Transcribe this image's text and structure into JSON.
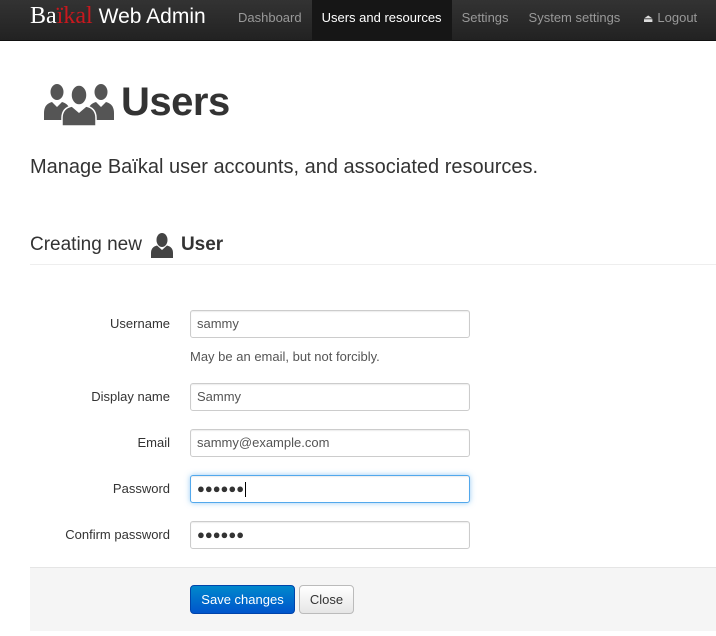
{
  "brand": {
    "part1": "Ba",
    "part2": "ïkal",
    "part3": "Web Admin"
  },
  "nav": {
    "items": [
      {
        "label": "Dashboard"
      },
      {
        "label": "Users and resources"
      },
      {
        "label": "Settings"
      },
      {
        "label": "System settings"
      }
    ],
    "logout_label": "Logout"
  },
  "page": {
    "title": "Users",
    "lead": "Manage Baïkal user accounts, and associated resources."
  },
  "section": {
    "prefix": "Creating new",
    "bold": "User"
  },
  "form": {
    "username_label": "Username",
    "username_value": "sammy",
    "username_help": "May be an email, but not forcibly.",
    "displayname_label": "Display name",
    "displayname_value": "Sammy",
    "email_label": "Email",
    "email_value": "sammy@example.com",
    "password_label": "Password",
    "password_value": "●●●●●●",
    "confirm_label": "Confirm password",
    "confirm_value": "●●●●●●"
  },
  "actions": {
    "save_label": "Save changes",
    "close_label": "Close"
  },
  "colors": {
    "brand_red": "#c8181e",
    "primary": "#0088cc",
    "navbar": "#222222"
  },
  "icons": {
    "page": "users-group-icon",
    "section": "user-icon",
    "logout": "eject-icon"
  }
}
